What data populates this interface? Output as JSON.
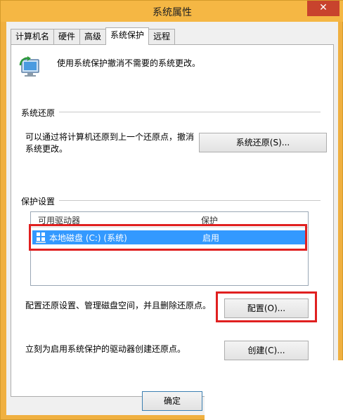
{
  "window": {
    "title": "系统属性",
    "close_glyph": "✕"
  },
  "tabs": [
    {
      "label": "计算机名",
      "active": false
    },
    {
      "label": "硬件",
      "active": false
    },
    {
      "label": "高级",
      "active": false
    },
    {
      "label": "系统保护",
      "active": true
    },
    {
      "label": "远程",
      "active": false
    }
  ],
  "intro": "使用系统保护撤消不需要的系统更改。",
  "restore": {
    "group_label": "系统还原",
    "description_line1": "可以通过将计算机还原到上一个还原点，撤消",
    "description_line2": "系统更改。",
    "button_label": "系统还原(S)..."
  },
  "protection": {
    "group_label": "保护设置",
    "columns": {
      "drive": "可用驱动器",
      "protection": "保护"
    },
    "rows": [
      {
        "drive": "本地磁盘 (C:) (系统)",
        "status": "启用"
      }
    ],
    "configure_text": "配置还原设置、管理磁盘空间，并且删除还原点。",
    "configure_button": "配置(O)...",
    "create_text": "立刻为启用系统保护的驱动器创建还原点。",
    "create_button": "创建(C)..."
  },
  "footer": {
    "ok_button": "确定"
  },
  "colors": {
    "accent": "#3399ff",
    "highlight": "#e02020",
    "titlebar": "#f5b744"
  }
}
